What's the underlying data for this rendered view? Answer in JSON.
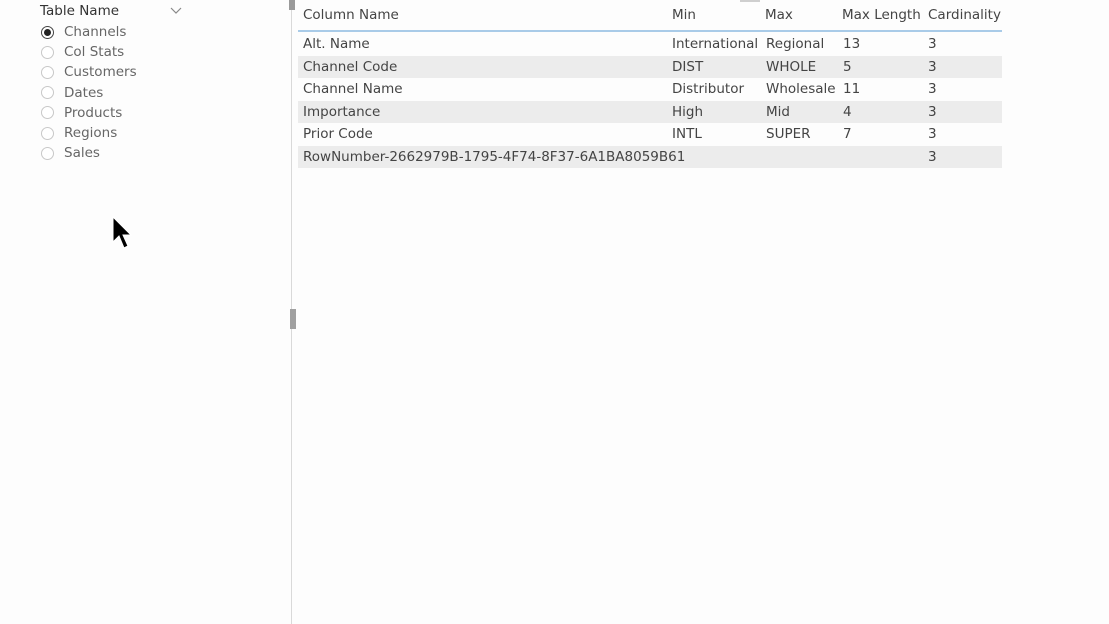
{
  "slicer": {
    "title": "Table Name",
    "selected": "Channels",
    "options": [
      {
        "label": "Channels",
        "checked": true
      },
      {
        "label": "Col Stats",
        "checked": false
      },
      {
        "label": "Customers",
        "checked": false
      },
      {
        "label": "Dates",
        "checked": false
      },
      {
        "label": "Products",
        "checked": false
      },
      {
        "label": "Regions",
        "checked": false
      },
      {
        "label": "Sales",
        "checked": false
      }
    ]
  },
  "table": {
    "columns": [
      "Column Name",
      "Min",
      "Max",
      "Max Length",
      "Cardinality"
    ],
    "rows": [
      [
        "Alt. Name",
        "International",
        "Regional",
        "13",
        "3"
      ],
      [
        "Channel Code",
        "DIST",
        "WHOLE",
        "5",
        "3"
      ],
      [
        "Channel Name",
        "Distributor",
        "Wholesale",
        "11",
        "3"
      ],
      [
        "Importance",
        "High",
        "Mid",
        "4",
        "3"
      ],
      [
        "Prior Code",
        "INTL",
        "SUPER",
        "7",
        "3"
      ],
      [
        "RowNumber-2662979B-1795-4F74-8F37-6A1BA8059B61",
        "",
        "",
        "",
        "3"
      ]
    ]
  },
  "colors": {
    "header_underline": "#a9cbe8",
    "alt_row": "#ececec"
  }
}
